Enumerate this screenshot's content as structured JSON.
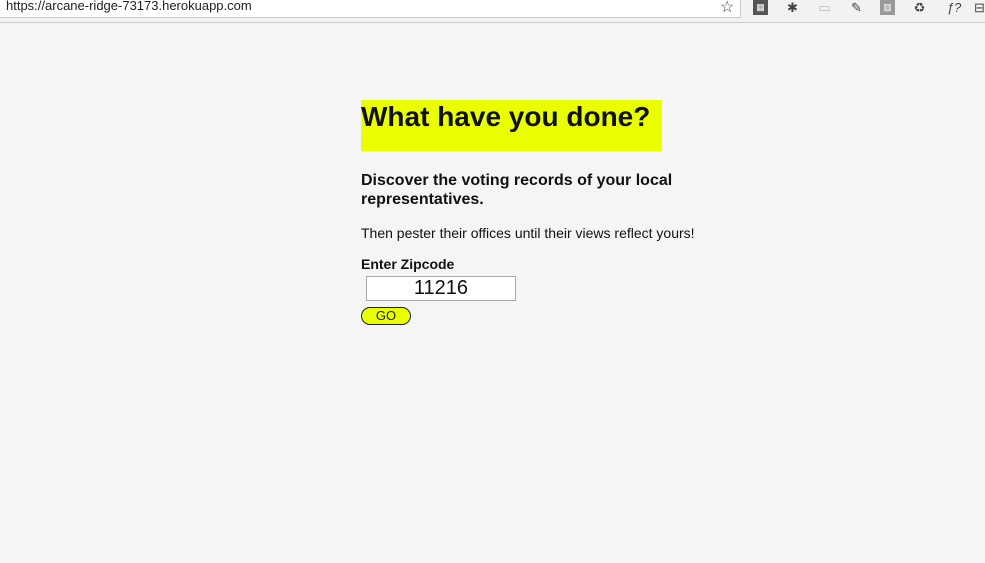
{
  "browser": {
    "url": "https://arcane-ridge-73173.herokuapp.com",
    "icons": [
      "star-icon",
      "qr-extension-icon",
      "bug-extension-icon",
      "page-extension-icon",
      "eyedropper-extension-icon",
      "tower-extension-icon",
      "recycle-extension-icon",
      "function-extension-icon",
      "menu-extension-icon"
    ]
  },
  "page": {
    "title": "What have you done?",
    "subtitle": "Discover the voting records of your local representatives.",
    "tagline": "Then pester their offices until their views reflect yours!",
    "zip_label": "Enter Zipcode",
    "zip_value": "11216",
    "go_label": "GO"
  },
  "colors": {
    "accent": "#eaff00",
    "background": "#f5f5f5"
  }
}
